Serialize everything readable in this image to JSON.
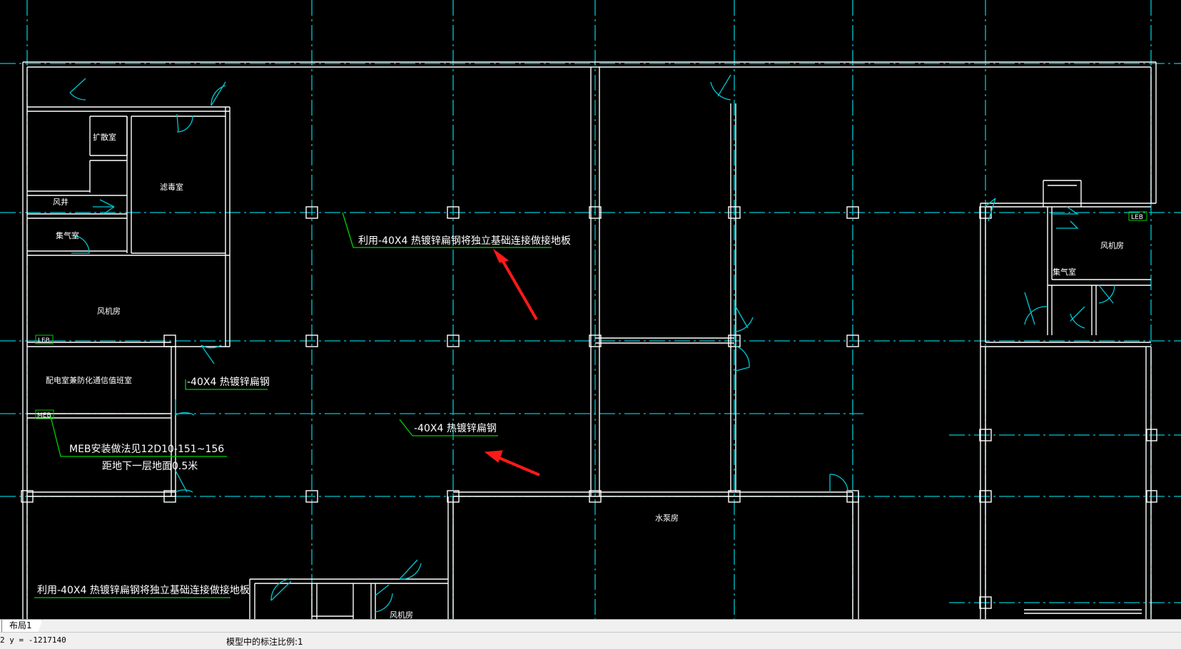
{
  "colors": {
    "background": "#000000",
    "wall": "#ffffff",
    "axis": "#00c8d2",
    "leader": "#00d000",
    "arrow": "#ff1a1a",
    "text": "#ffffff"
  },
  "rooms": {
    "expansion": "扩散室",
    "decon": "滤毒室",
    "shaft": "风井",
    "air_collect_left": "集气室",
    "fan_room_left": "风机房",
    "distribution": "配电室兼防化通信值班室",
    "fan_room_right": "风机房",
    "air_collect_right": "集气室",
    "pump_room": "水泵房",
    "fan_room_bottom": "风机房"
  },
  "annotations": {
    "ground_top": "利用-40X4 热镀锌扁钢将独立基础连接做接地板",
    "steel_left": "-40X4 热镀锌扁钢",
    "steel_center": "-40X4 热镀锌扁钢",
    "meb_install": "MEB安装做法见12D10-151~156",
    "meb_height": "距地下一层地面0.5米",
    "ground_bottom": "利用-40X4 热镀锌扁钢将独立基础连接做接地板"
  },
  "tags": {
    "leb_left": "LEB",
    "meb_left": "MEB",
    "leb_right": "LEB"
  },
  "tabs": {
    "layout1": "布局1"
  },
  "status": {
    "coords": "2 y = -1217140",
    "scale": "模型中的标注比例:1"
  }
}
